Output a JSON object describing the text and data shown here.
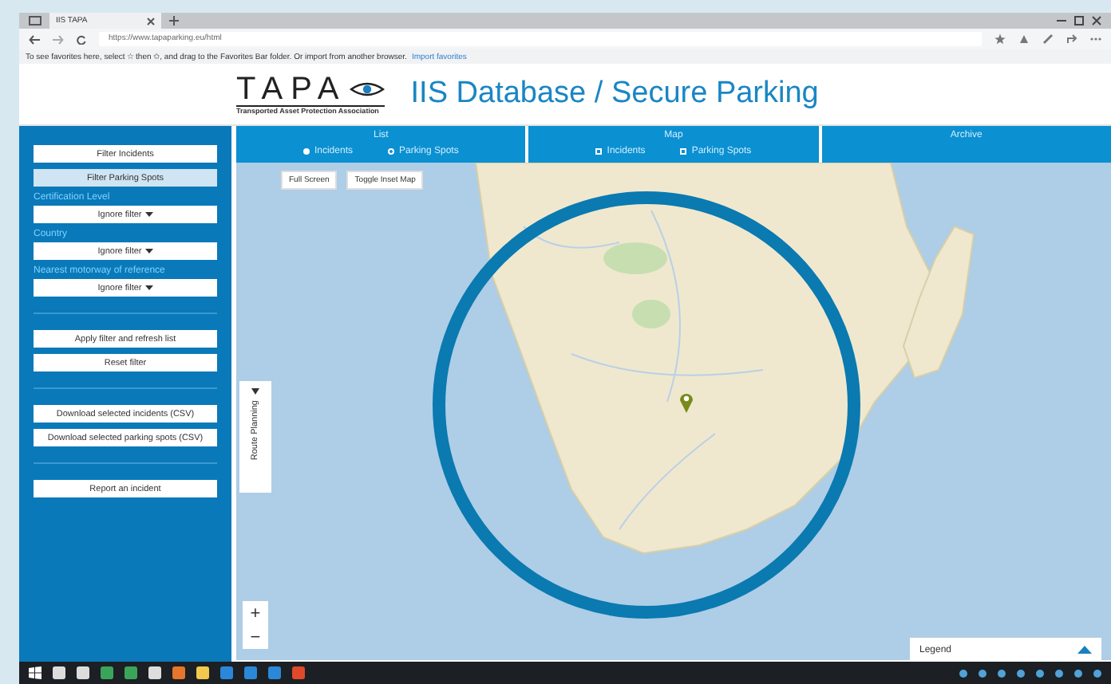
{
  "browser": {
    "tab_title": "IIS TAPA",
    "url": "https://www.tapaparking.eu/html",
    "favorites_hint": "To see favorites here, select ☆ then ✩, and drag to the Favorites Bar folder. Or import from another browser.",
    "favorites_link": "Import favorites"
  },
  "header": {
    "logo_text": "TAPA",
    "logo_tagline": "Transported Asset Protection Association",
    "title": "IIS Database / Secure Parking"
  },
  "sidebar": {
    "items": [
      {
        "kind": "button",
        "label": "Filter Incidents",
        "selected": false
      },
      {
        "kind": "button",
        "label": "Filter Parking Spots",
        "selected": true
      },
      {
        "kind": "label",
        "label": "Certification Level"
      },
      {
        "kind": "dropdown",
        "label": "Ignore filter"
      },
      {
        "kind": "label",
        "label": "Country"
      },
      {
        "kind": "dropdown",
        "label": "Ignore filter"
      },
      {
        "kind": "label",
        "label": "Nearest motorway of reference"
      },
      {
        "kind": "dropdown",
        "label": "Ignore filter"
      },
      {
        "kind": "divider"
      },
      {
        "kind": "button",
        "label": "Apply filter and refresh list",
        "selected": false
      },
      {
        "kind": "button",
        "label": "Reset filter",
        "selected": false
      },
      {
        "kind": "divider"
      },
      {
        "kind": "button",
        "label": "Download selected incidents (CSV)",
        "selected": false
      },
      {
        "kind": "button",
        "label": "Download selected parking spots (CSV)",
        "selected": false
      },
      {
        "kind": "divider"
      },
      {
        "kind": "button",
        "label": "Report an incident",
        "selected": false
      }
    ]
  },
  "tabs": [
    {
      "label": "List",
      "options": [
        {
          "kind": "radio",
          "label": "Incidents",
          "selected": true
        },
        {
          "kind": "radio",
          "label": "Parking Spots",
          "selected": false
        }
      ]
    },
    {
      "label": "Map",
      "options": [
        {
          "kind": "checkbox",
          "label": "Incidents",
          "checked": false
        },
        {
          "kind": "checkbox",
          "label": "Parking Spots",
          "checked": false
        }
      ]
    },
    {
      "label": "Archive"
    }
  ],
  "map": {
    "controls": [
      "Full Screen",
      "Toggle Inset Map"
    ],
    "side_tab": "Route Planning",
    "zoom_in": "+",
    "zoom_out": "−",
    "legend": {
      "label": "Legend",
      "expanded": false
    }
  }
}
